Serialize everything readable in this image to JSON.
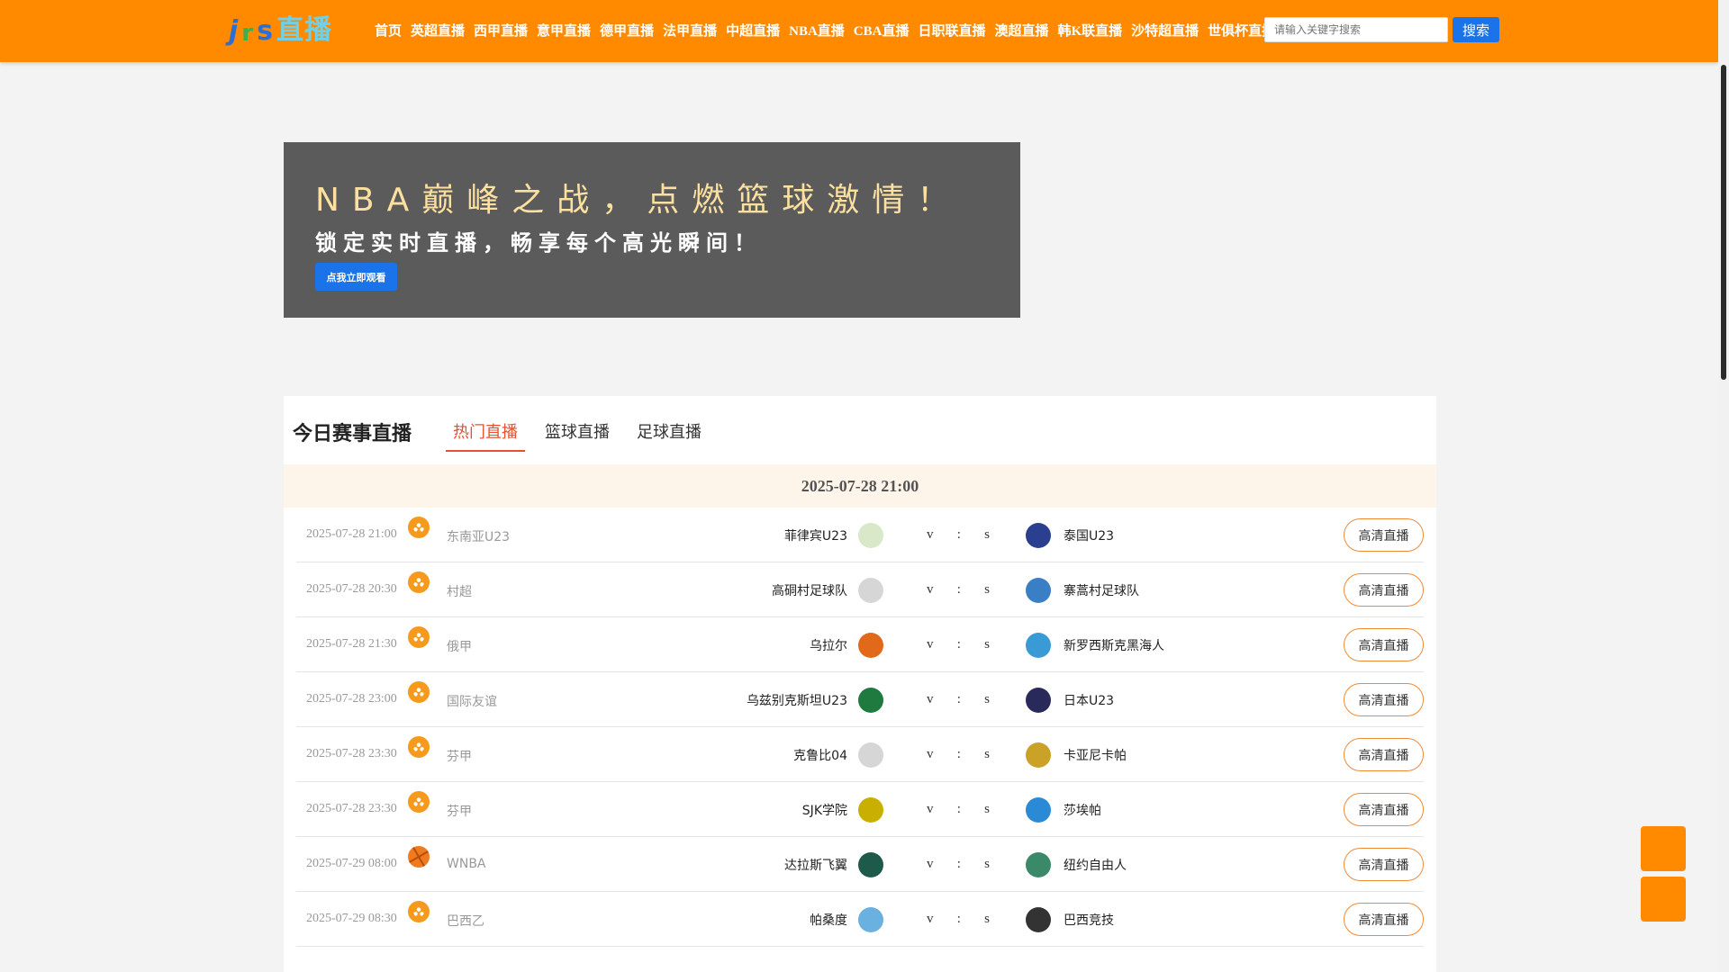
{
  "header": {
    "logo": {
      "l1": "j",
      "l2": "r",
      "l3": "s",
      "l4": "直播"
    },
    "nav": [
      "首页",
      "英超直播",
      "西甲直播",
      "意甲直播",
      "德甲直播",
      "法甲直播",
      "中超直播",
      "NBA直播",
      "CBA直播",
      "日职联直播",
      "澳超直播",
      "韩K联直播",
      "沙特超直播",
      "世俱杯直播"
    ],
    "search_placeholder": "请输入关键字搜索",
    "search_label": "搜索"
  },
  "banner": {
    "title": "NBA巅峰之战，点燃篮球激情！",
    "subtitle": "锁定实时直播，畅享每个高光瞬间！",
    "button": "点我立即观看"
  },
  "main": {
    "title": "今日赛事直播",
    "tabs": [
      "热门直播",
      "篮球直播",
      "足球直播"
    ],
    "active_tab": 0,
    "date_header": "2025-07-28 21:00",
    "vs": [
      "v",
      ":",
      "s"
    ],
    "live_label": "高清直播",
    "matches": [
      {
        "time": "2025-07-28 21:00",
        "sport": "football",
        "league": "东南亚U23",
        "home": "菲律宾U23",
        "away": "泰国U23",
        "home_color": "#d8e8c8",
        "away_color": "#2a3f8f"
      },
      {
        "time": "2025-07-28 20:30",
        "sport": "football",
        "league": "村超",
        "home": "高硐村足球队",
        "away": "寨蒿村足球队",
        "home_color": "#d6d6d6",
        "away_color": "#3a7fc6"
      },
      {
        "time": "2025-07-28 21:30",
        "sport": "football",
        "league": "俄甲",
        "home": "乌拉尔",
        "away": "新罗西斯克黑海人",
        "home_color": "#e06a1a",
        "away_color": "#3a9ad6"
      },
      {
        "time": "2025-07-28 23:00",
        "sport": "football",
        "league": "国际友谊",
        "home": "乌兹别克斯坦U23",
        "away": "日本U23",
        "home_color": "#1e7a3e",
        "away_color": "#2a2a5a"
      },
      {
        "time": "2025-07-28 23:30",
        "sport": "football",
        "league": "芬甲",
        "home": "克鲁比04",
        "away": "卡亚尼卡帕",
        "home_color": "#d6d6d6",
        "away_color": "#c9a227"
      },
      {
        "time": "2025-07-28 23:30",
        "sport": "football",
        "league": "芬甲",
        "home": "SJK学院",
        "away": "莎埃帕",
        "home_color": "#c9b000",
        "away_color": "#2a8ad6"
      },
      {
        "time": "2025-07-29 08:00",
        "sport": "basketball",
        "league": "WNBA",
        "home": "达拉斯飞翼",
        "away": "纽约自由人",
        "home_color": "#1e5a4a",
        "away_color": "#3a8a6a"
      },
      {
        "time": "2025-07-29 08:30",
        "sport": "football",
        "league": "巴西乙",
        "home": "帕桑度",
        "away": "巴西竞技",
        "home_color": "#6ab0e0",
        "away_color": "#333333"
      }
    ]
  }
}
